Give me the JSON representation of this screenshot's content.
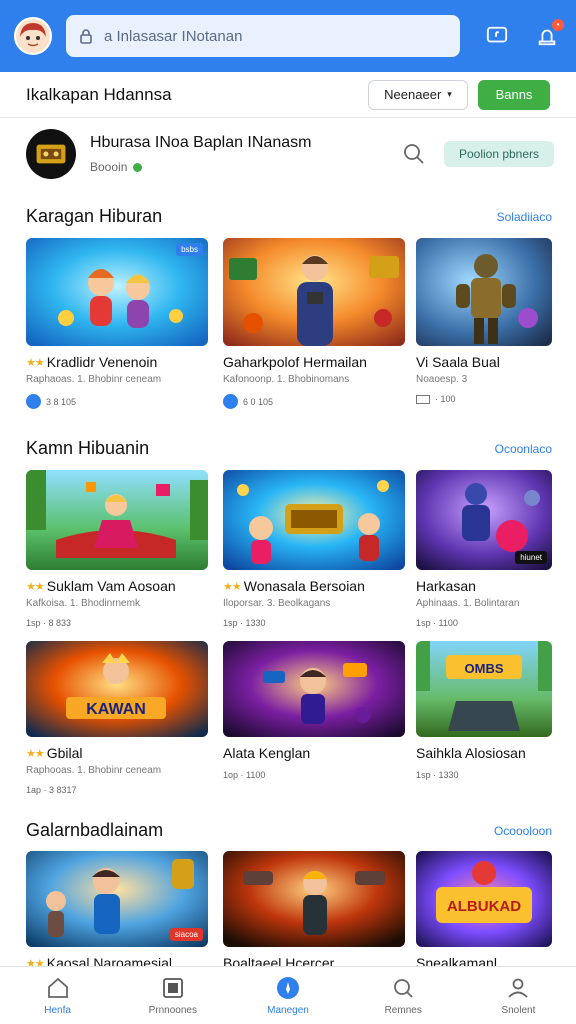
{
  "browser": {
    "url": "a Inlasasar INotanan"
  },
  "header": {
    "title": "Ikalkapan Hdannsa",
    "select_label": "Neenaeer",
    "action_label": "Banns"
  },
  "store": {
    "name": "Hburasa INoa Baplan INanasm",
    "status": "Boooin",
    "pill_label": "Poolion pbners"
  },
  "sections": [
    {
      "title": "Karagan Hiburan",
      "link": "Soladiiaco",
      "cards": [
        {
          "title": "Kradlidr Venenoin",
          "stars": "★★",
          "sub": "Raphaoas. 1. Bhobinr ceneam",
          "meta": "3 8 105",
          "tag": "bsbs"
        },
        {
          "title": "Gaharkpolof Hermailan",
          "stars": "",
          "sub": "Kafonoonp. 1. Bhobinomans",
          "meta": "6 0 105",
          "tag": ""
        },
        {
          "title": "Vi Saala Bual",
          "stars": "",
          "sub": "Noaoesp. 3",
          "meta": "· 100",
          "tag": ""
        }
      ]
    },
    {
      "title": "Kamn Hibuanin",
      "link": "Ocoonlaco",
      "cards": [
        {
          "title": "Suklam Vam Aosoan",
          "stars": "★★",
          "sub": "Kafkoisa. 1. Bhodinrnemk",
          "meta": "1sp · 8 833",
          "tag": ""
        },
        {
          "title": "Wonasala Bersoian",
          "stars": "★★",
          "sub": "Iloporsar. 3. Beolkagans",
          "meta": "1sp · 1330",
          "tag": ""
        },
        {
          "title": "Harkasan",
          "stars": "",
          "sub": "Aphinaas. 1. Bolintaran",
          "meta": "1sp · 1100",
          "tag": "hiunet"
        },
        {
          "title": "Gbilal",
          "stars": "★★",
          "sub": "Raphooas. 1. Bhobinr ceneam",
          "meta": "1ap · 3 8317",
          "tag": ""
        },
        {
          "title": "Alata Kenglan",
          "stars": "",
          "sub": "",
          "meta": "1op · 1100",
          "tag": ""
        },
        {
          "title": "Saihkla Alosiosan",
          "stars": "",
          "sub": "",
          "meta": "1sp · 1330",
          "tag": ""
        }
      ]
    },
    {
      "title": "Galarnbadlainam",
      "link": "Ocoooloon",
      "cards": [
        {
          "title": "Kaosal Naroamesial",
          "stars": "★★",
          "sub": "",
          "meta": "",
          "tag": "siacoa"
        },
        {
          "title": "Boaltaeel Hcercer",
          "stars": "",
          "sub": "",
          "meta": "",
          "tag": ""
        },
        {
          "title": "Snealkamanl",
          "stars": "",
          "sub": "",
          "meta": "",
          "tag": ""
        }
      ]
    }
  ],
  "nav": [
    {
      "label": "Henfa",
      "icon": "home-icon"
    },
    {
      "label": "Prnnoones",
      "icon": "square-icon"
    },
    {
      "label": "Manegen",
      "icon": "compass-icon"
    },
    {
      "label": "Remnes",
      "icon": "search-icon"
    },
    {
      "label": "Snolent",
      "icon": "user-icon"
    }
  ],
  "colors": {
    "primary": "#2f80ed",
    "green": "#3fae45",
    "star": "#f2b01e"
  }
}
